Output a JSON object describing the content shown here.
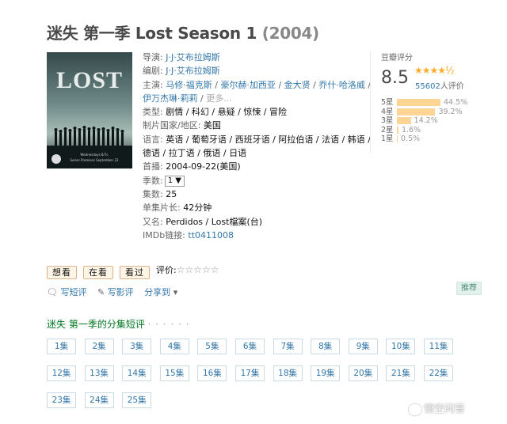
{
  "title": {
    "main": "迷失 第一季 Lost Season 1",
    "year": "(2004)"
  },
  "poster": {
    "logo_text": "LOST",
    "caption_line1": "Wednesdays 8/7c",
    "caption_line2": "Series Premiere September 22"
  },
  "info": {
    "director_label": "导演:",
    "director": "J·J·艾布拉姆斯",
    "writer_label": "编剧:",
    "writer": "J·J·艾布拉姆斯",
    "cast_label": "主演:",
    "cast": [
      "马修·福克斯",
      "豪尔赫·加西亚",
      "金大贤",
      "乔什·哈洛威",
      "伊万杰琳·莉莉"
    ],
    "cast_more": "更多...",
    "genre_label": "类型:",
    "genre": "剧情 / 科幻 / 悬疑 / 惊悚 / 冒险",
    "country_label": "制片国家/地区:",
    "country": "美国",
    "language_label": "语言:",
    "language_line1": "英语 / 葡萄牙语 / 西班牙语 / 阿拉伯语 / 法语 / 韩语 /",
    "language_line2": "德语 / 拉丁语 / 俄语 / 日语",
    "premiere_label": "首播:",
    "premiere": "2004-09-22(美国)",
    "season_label": "季数:",
    "season_value": "1 ▼",
    "episodes_label": "集数:",
    "episodes": "25",
    "runtime_label": "单集片长:",
    "runtime": "42分钟",
    "aka_label": "又名:",
    "aka": "Perdidos / Lost檔案(台)",
    "imdb_label": "IMDb链接:",
    "imdb": "tt0411008"
  },
  "rating": {
    "title": "豆瓣评分",
    "score": "8.5",
    "stars": "★★★★½",
    "votes": "55602",
    "votes_suffix": "人评价",
    "distribution": [
      {
        "label": "5星",
        "percent": 44.5,
        "text": "44.5%"
      },
      {
        "label": "4星",
        "percent": 39.2,
        "text": "39.2%"
      },
      {
        "label": "3星",
        "percent": 14.2,
        "text": "14.2%"
      },
      {
        "label": "2星",
        "percent": 1.6,
        "text": "1.6%"
      },
      {
        "label": "1星",
        "percent": 0.5,
        "text": "0.5%"
      }
    ]
  },
  "actions": {
    "want": "想看",
    "watching": "在看",
    "watched": "看过",
    "rate_label": "评价:",
    "empty_stars": "☆☆☆☆☆"
  },
  "tools": {
    "short_review": "写短评",
    "review": "写影评",
    "share": "分享到",
    "share_caret": "▾"
  },
  "recommend": "推荐",
  "section": {
    "title": "迷失 第一季的分集短评",
    "dots": "· · · · · ·"
  },
  "episode_list": [
    "1集",
    "2集",
    "3集",
    "4集",
    "5集",
    "6集",
    "7集",
    "8集",
    "9集",
    "10集",
    "11集",
    "12集",
    "13集",
    "14集",
    "15集",
    "16集",
    "17集",
    "18集",
    "19集",
    "20集",
    "21集",
    "22集",
    "23集",
    "24集",
    "25集"
  ],
  "watermark": "悟空问答",
  "colors": {
    "link": "#3377aa",
    "green": "#007722",
    "star": "#ffac2d",
    "bar": "#ffd596"
  }
}
